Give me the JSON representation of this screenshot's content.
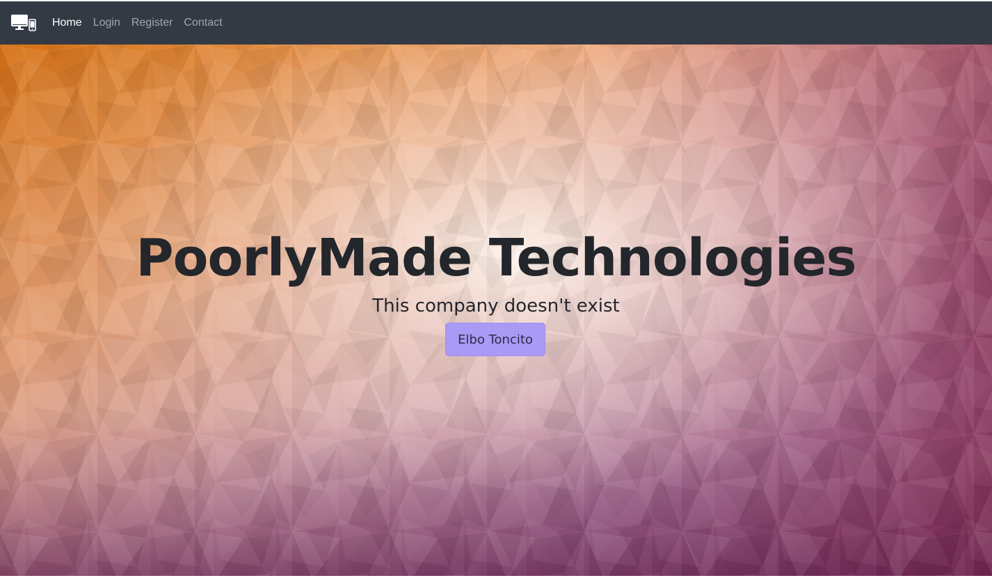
{
  "navbar": {
    "brand_icon": "devices-icon",
    "links": [
      {
        "label": "Home",
        "active": true
      },
      {
        "label": "Login",
        "active": false
      },
      {
        "label": "Register",
        "active": false
      },
      {
        "label": "Contact",
        "active": false
      }
    ],
    "background_color": "#333a44"
  },
  "hero": {
    "title": "PoorlyMade Technologies",
    "subtitle": "This company doesn't exist",
    "button_label": "Elbo Toncito",
    "button_color": "#a99af5",
    "background_colors": {
      "top_left": "#d9781a",
      "top_right": "#8f3050",
      "center": "#fbe6dc",
      "bottom_left": "#8a3d5c",
      "bottom_right": "#451a7a"
    }
  }
}
